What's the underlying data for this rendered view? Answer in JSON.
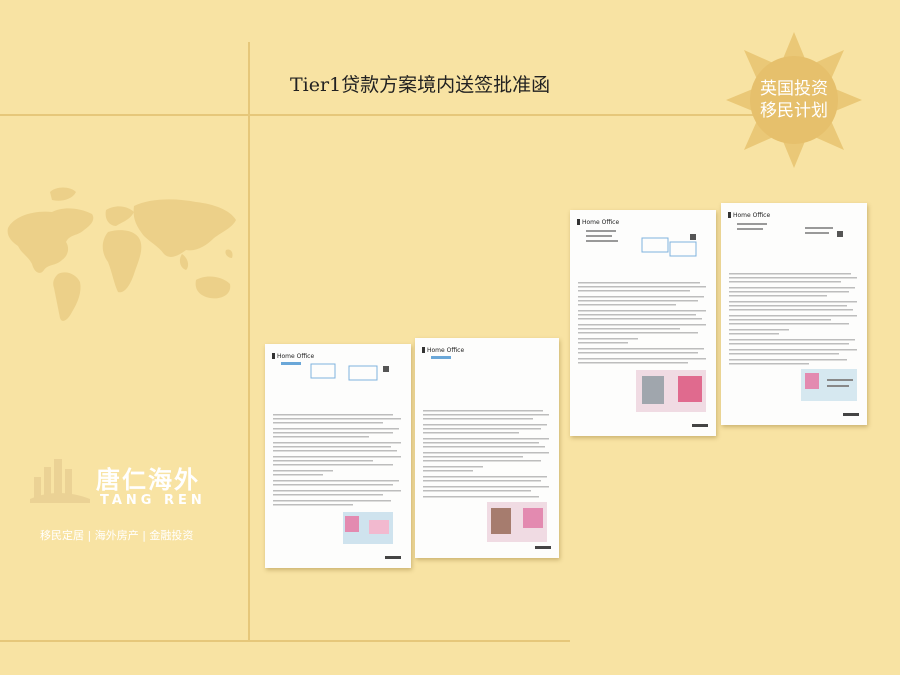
{
  "page": {
    "title": "Tier1贷款方案境内送签批准函",
    "badge": {
      "line1": "英国投资",
      "line2": "移民计划"
    },
    "brand": {
      "name_cn": "唐仁海外",
      "name_en": "TANG REN",
      "tagline": "移民定居 | 海外房产 | 金融投资"
    },
    "documents": [
      {
        "header": "Home Office"
      },
      {
        "header": "Home Office"
      },
      {
        "header": "Home Office"
      },
      {
        "header": "Home Office"
      }
    ]
  },
  "colors": {
    "background": "#f8e3a3",
    "divider": "#e6c77a",
    "badge": "#eac877",
    "map": "#ecd089",
    "logo": "#ebd295"
  },
  "icons": [
    "world-map-icon",
    "sun-badge-icon",
    "building-logo-icon"
  ]
}
